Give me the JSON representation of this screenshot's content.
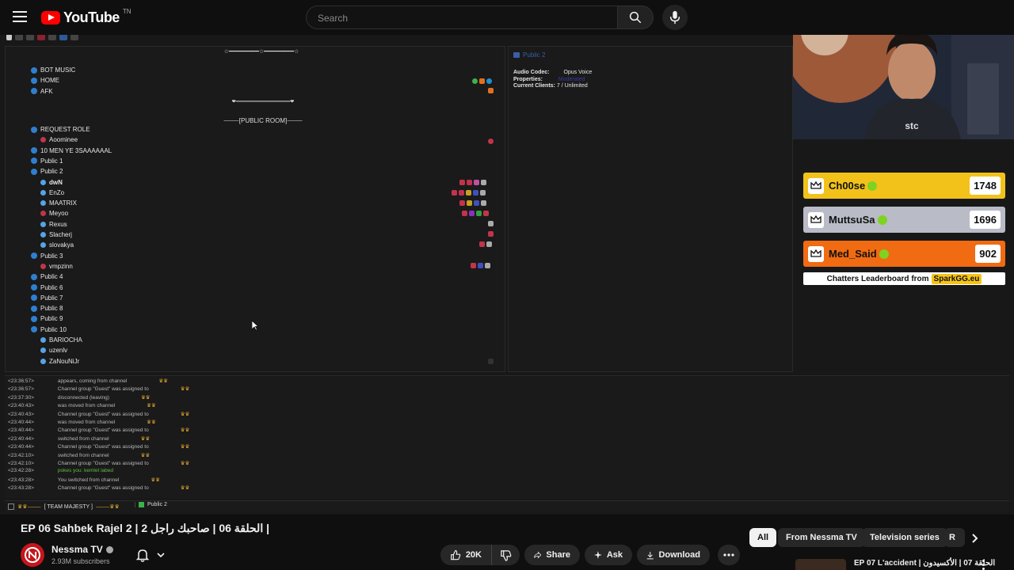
{
  "header": {
    "logo_text": "YouTube",
    "logo_sup": "TN",
    "search_placeholder": "Search",
    "icons": [
      "menu-icon",
      "search-icon",
      "mic-icon"
    ]
  },
  "teamspeak": {
    "deco_top": "☆━━━━━━━━━☆━━━━━━━━━☆",
    "channels_top": [
      "BOT MUSIC",
      "HOME",
      "AFK"
    ],
    "public_room": "⸻[PUBLIC ROOM]⸻",
    "channels": [
      {
        "label": "REQUEST ROLE"
      },
      {
        "label": "Aoominee",
        "user": true,
        "red": true
      },
      {
        "label": "10 MEN YE 3SAAAAAAL"
      },
      {
        "label": "Public 1"
      },
      {
        "label": "Public 2"
      },
      {
        "label": "dwN",
        "user": true,
        "bold": true
      },
      {
        "label": "EnZo",
        "user": true
      },
      {
        "label": "MAATRIX",
        "user": true
      },
      {
        "label": "Meyoo",
        "user": true,
        "red": true
      },
      {
        "label": "Rexus",
        "user": true
      },
      {
        "label": "Slacherj",
        "user": true
      },
      {
        "label": "slovakya",
        "user": true
      },
      {
        "label": "Public 3"
      },
      {
        "label": "vmpzinn",
        "user": true,
        "red": true
      },
      {
        "label": "Public 4"
      },
      {
        "label": "Public 6"
      },
      {
        "label": "Public 7"
      },
      {
        "label": "Public 8"
      },
      {
        "label": "Public 9"
      },
      {
        "label": "Public 10"
      },
      {
        "label": "BARIOCHA",
        "user": true
      },
      {
        "label": "uzenlv",
        "user": true
      },
      {
        "label": "ZaNouNiJr",
        "user": true
      }
    ],
    "info": {
      "title": "Public 2",
      "audio_codec_label": "Audio Codec:",
      "audio_codec_value": "Opus Voice",
      "properties_label": "Properties:",
      "properties_value": "Moderated",
      "clients_label": "Current Clients:",
      "clients_value": "7 / Unlimited"
    },
    "log": [
      {
        "t": "<23:36:57>",
        "msg": "appears, coming from channel"
      },
      {
        "t": "<23:36:57>",
        "msg": "Channel group \"Guest\" was assigned to"
      },
      {
        "t": "<23:37:30>",
        "msg": "disconnected (leaving)"
      },
      {
        "t": "<23:40:43>",
        "msg": "was moved from channel"
      },
      {
        "t": "<23:40:43>",
        "msg": "Channel group \"Guest\" was assigned to"
      },
      {
        "t": "<23:40:44>",
        "msg": "was moved from channel"
      },
      {
        "t": "<23:40:44>",
        "msg": "Channel group \"Guest\" was assigned to"
      },
      {
        "t": "<23:40:44>",
        "msg": "switched from channel"
      },
      {
        "t": "<23:40:44>",
        "msg": "Channel group \"Guest\" was assigned to"
      },
      {
        "t": "<23:42:10>",
        "msg": "switched from channel"
      },
      {
        "t": "<23:42:10>",
        "msg": "Channel group \"Guest\" was assigned to"
      },
      {
        "t": "<23:42:28>",
        "msg": "pokes you: kemlet labed",
        "green": true
      },
      {
        "t": "<23:43:28>",
        "msg": "You switched from channel"
      },
      {
        "t": "<23:43:28>",
        "msg": "Channel group \"Guest\" was assigned to"
      }
    ],
    "tabs": [
      "[ TEAM MAJESTY ]",
      "Public 2"
    ]
  },
  "leaderboard": {
    "rows": [
      {
        "name": "Ch00se",
        "score": "1748",
        "color": "#f2c21b"
      },
      {
        "name": "MuttsuSa",
        "score": "1696",
        "color": "#b9bcc6"
      },
      {
        "name": "Med_Said",
        "score": "902",
        "color": "#f06b12"
      }
    ],
    "footer_text": "Chatters Leaderboard from",
    "footer_brand": "SparkGG.eu"
  },
  "video": {
    "title": "EP 06 Sahbek Rajel 2 | الحلقة 06 | صاحبك راجل 2 |",
    "channel": "Nessma TV",
    "subscribers": "2.93M subscribers",
    "likes": "20K",
    "share_label": "Share",
    "ask_label": "Ask",
    "download_label": "Download"
  },
  "chips": [
    "All",
    "From Nessma TV",
    "Television series",
    "R"
  ],
  "next_video": {
    "title": "EP 07 L'accident | الحلقة 07 | الأكسيدون"
  }
}
